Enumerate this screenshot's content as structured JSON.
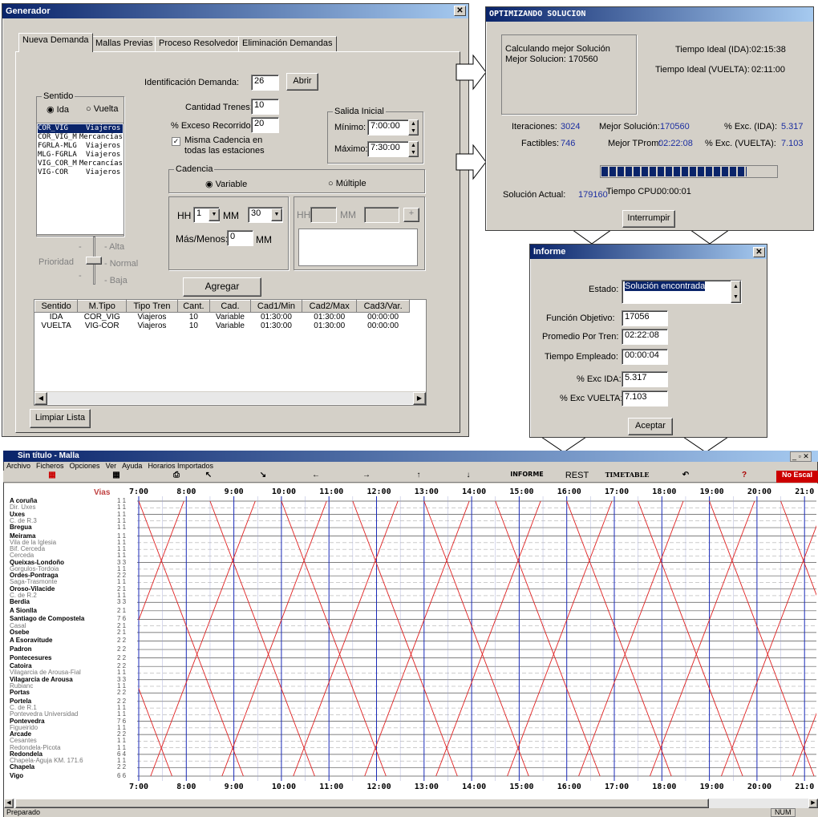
{
  "generador": {
    "title": "Generador",
    "tabs": [
      "Nueva Demanda",
      "Mallas Previas",
      "Proceso Resolvedor",
      "Eliminación Demandas"
    ],
    "sentido_label": "Sentido",
    "ida": "Ida",
    "vuelta": "Vuelta",
    "list": [
      [
        "COR_VIG",
        "Viajeros"
      ],
      [
        "COR_VIG_M",
        "Mercancías"
      ],
      [
        "FGRLA-MLG",
        "Viajeros"
      ],
      [
        "MLG-FGRLA",
        "Viajeros"
      ],
      [
        "VIG_COR_M",
        "Mercancías"
      ],
      [
        "VIG-COR",
        "Viajeros"
      ]
    ],
    "id_label": "Identificación Demanda:",
    "id_value": "26",
    "abrir": "Abrir",
    "trenes_label": "Cantidad Trenes:",
    "trenes_value": "10",
    "exceso_label": "% Exceso Recorrido:",
    "exceso_value": "20",
    "misma_line1": "Misma Cadencia en",
    "misma_line2": "todas las estaciones",
    "salida_label": "Salida Inicial",
    "min_label": "Mínimo:",
    "min_value": "7:00:00",
    "max_label": "Máximo:",
    "max_value": "7:30:00",
    "cadencia_label": "Cadencia",
    "variable": "Variable",
    "multiple": "Múltiple",
    "hh": "HH",
    "hh_value": "1",
    "mm": "MM",
    "mm_value": "30",
    "masmenos": "Más/Menos:",
    "masmenos_value": "0",
    "mm2": "MM",
    "prioridad": "Prioridad",
    "alta": "- Alta",
    "normal": "- Normal",
    "baja": "- Baja",
    "agregar": "Agregar",
    "table_headers": [
      "Sentido",
      "M.Tipo",
      "Tipo Tren",
      "Cant.",
      "Cad.",
      "Cad1/Min",
      "Cad2/Max",
      "Cad3/Var."
    ],
    "table_rows": [
      [
        "IDA",
        "COR_VIG",
        "Viajeros",
        "10",
        "Variable",
        "01:30:00",
        "01:30:00",
        "00:00:00"
      ],
      [
        "VUELTA",
        "VIG-COR",
        "Viajeros",
        "10",
        "Variable",
        "01:30:00",
        "01:30:00",
        "00:00:00"
      ]
    ],
    "limpiar": "Limpiar Lista"
  },
  "opt": {
    "title": "OPTIMIZANDO SOLUCION",
    "calc1": "Calculando mejor Solución",
    "calc2": "Mejor Solucion: 170560",
    "ti_ida_label": "Tiempo Ideal (IDA):",
    "ti_ida": "02:15:38",
    "ti_vuelta_label": "Tiempo Ideal (VUELTA):",
    "ti_vuelta": "02:11:00",
    "iter_label": "Iteraciones:",
    "iter": "3024",
    "mejor_label": "Mejor Solución:",
    "mejor": "170560",
    "exc_ida_label": "% Exc. (IDA):",
    "exc_ida": "5.317",
    "fact_label": "Factibles:",
    "fact": "746",
    "tprom_label": "Mejor TProm:",
    "tprom": "02:22:08",
    "exc_v_label": "% Exc. (VUELTA):",
    "exc_v": "7.103",
    "progress": 0.83,
    "actual_label": "Solución Actual:",
    "actual": "179160",
    "cpu_label": "Tiempo CPU:",
    "cpu": "00:00:01",
    "interrumpir": "Interrumpir"
  },
  "informe": {
    "title": "Informe",
    "estado_label": "Estado:",
    "estado": "Solución encontrada",
    "fo_label": "Función Objetivo:",
    "fo": "17056",
    "prom_label": "Promedio Por Tren:",
    "prom": "02:22:08",
    "temp_label": "Tiempo Empleado:",
    "temp": "00:00:04",
    "excida_label": "% Exc IDA:",
    "excida": "5.317",
    "excv_label": "% Exc VUELTA:",
    "excv": "7.103",
    "aceptar": "Aceptar"
  },
  "malla": {
    "title": "Sin título - Malla",
    "menu": [
      "Archivo",
      "Ficheros",
      "Opciones",
      "Ver",
      "Ayuda",
      "Horarios Importados"
    ],
    "toolbar": [
      "INFORME",
      "REST",
      "TIMETABLE",
      "No Escal"
    ],
    "vias_label": "Vias",
    "hours": [
      "7:00",
      "8:00",
      "9:00",
      "10:00",
      "11:00",
      "12:00",
      "13:00",
      "14:00",
      "15:00",
      "16:00",
      "17:00",
      "18:00",
      "19:00",
      "20:00",
      "21:0"
    ],
    "status": "Preparado",
    "num": "NUM",
    "stations": [
      [
        "A coruña",
        "1 1",
        1
      ],
      [
        "Dir. Uxes",
        "1 1",
        0
      ],
      [
        "Uxes",
        "1 1",
        1
      ],
      [
        "C. de R.3",
        "1 1",
        0
      ],
      [
        "Bregua",
        "1 1",
        1
      ],
      [
        "Meirama",
        "1 1",
        1
      ],
      [
        "Vila de la Iglesia",
        "1 1",
        0
      ],
      [
        "Bif. Cerceda",
        "1 1",
        0
      ],
      [
        "Cerceda",
        "1 1",
        0
      ],
      [
        "Queixas-Londoño",
        "3 3",
        1
      ],
      [
        "Gorgulos-Tordoia",
        "1 1",
        0
      ],
      [
        "Ordes-Pontraga",
        "2 2",
        1
      ],
      [
        "Saga-Trasmonte",
        "1 1",
        0
      ],
      [
        "Oroso-Vilacide",
        "2 1",
        1
      ],
      [
        "C. de R.2",
        "1 1",
        0
      ],
      [
        "Berdia",
        "3 3",
        1
      ],
      [
        "A Sionlla",
        "2 1",
        1
      ],
      [
        "Santiago de Compostela",
        "7 6",
        1
      ],
      [
        "Casal",
        "2 1",
        0
      ],
      [
        "Osebe",
        "2 1",
        1
      ],
      [
        "A Esoravitude",
        "2 2",
        1
      ],
      [
        "Padron",
        "2 2",
        1
      ],
      [
        "Pontecesures",
        "2 2",
        1
      ],
      [
        "Catoira",
        "2 2",
        1
      ],
      [
        "Vilagarcia de Arousa-Fial",
        "1 1",
        0
      ],
      [
        "Vilagarcia de Arousa",
        "3 3",
        1
      ],
      [
        "Rubianc",
        "1 1",
        0
      ],
      [
        "Portas",
        "2 2",
        1
      ],
      [
        "Portela",
        "2 2",
        1
      ],
      [
        "C. de R.1",
        "1 1",
        0
      ],
      [
        "Pontevedra Universidad",
        "1 1",
        0
      ],
      [
        "Pontevedra",
        "7 6",
        1
      ],
      [
        "Figueirido",
        "1 1",
        0
      ],
      [
        "Arcade",
        "2 2",
        1
      ],
      [
        "Cesantes",
        "1 1",
        0
      ],
      [
        "Redondela-Picota",
        "1 1",
        0
      ],
      [
        "Redondela",
        "6 4",
        1
      ],
      [
        "Chapela-Aguja KM. 171.6",
        "1 1",
        0
      ],
      [
        "Chapela",
        "2 2",
        1
      ],
      [
        "Vigo",
        "6 6",
        1
      ]
    ]
  }
}
